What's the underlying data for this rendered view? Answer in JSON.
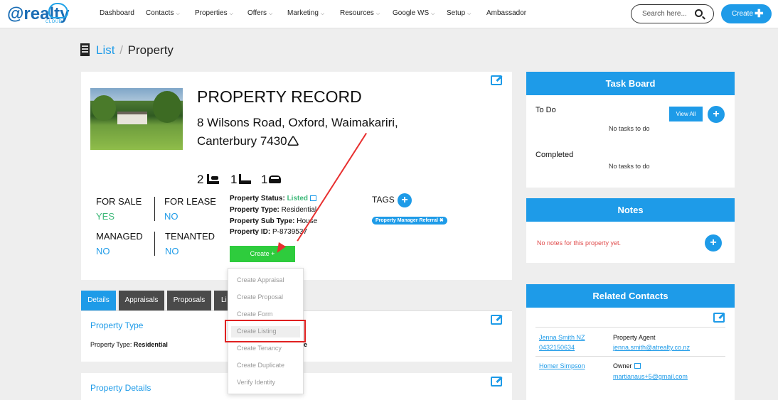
{
  "nav": {
    "logo_text": "@realty",
    "logo_sub": "CLOUD",
    "items": [
      {
        "label": "Dashboard",
        "dropdown": false
      },
      {
        "label": "Contacts",
        "dropdown": true
      },
      {
        "label": "Properties",
        "dropdown": true
      },
      {
        "label": "Offers",
        "dropdown": true
      },
      {
        "label": "Marketing",
        "dropdown": true
      },
      {
        "label": "Resources",
        "dropdown": true
      },
      {
        "label": "Google WS",
        "dropdown": true
      },
      {
        "label": "Setup",
        "dropdown": true
      },
      {
        "label": "Ambassador",
        "dropdown": false
      }
    ],
    "search_placeholder": "Search here...",
    "create_label": "Create",
    "create_plus": "✚"
  },
  "breadcrumb": {
    "parent": "List",
    "separator": "/",
    "current": "Property"
  },
  "record": {
    "title": "PROPERTY RECORD",
    "address": "8 Wilsons Road, Oxford, Waimakariri, Canterbury 7430",
    "address_icon": "🛆",
    "beds": "2",
    "baths": "1",
    "cars": "1",
    "for_sale_label": "FOR SALE",
    "for_sale_value": "YES",
    "for_lease_label": "FOR LEASE",
    "for_lease_value": "NO",
    "managed_label": "MANAGED",
    "managed_value": "NO",
    "tenanted_label": "TENANTED",
    "tenanted_value": "NO",
    "status_label": "Property Status:",
    "status_value": "Listed",
    "type_label": "Property Type:",
    "type_value": "Residential",
    "subtype_label": "Property Sub Type:",
    "subtype_value": "House",
    "id_label": "Property ID:",
    "id_value": "P-8739537",
    "tags_label": "TAGS",
    "tag": "Property Manager Referral ✖",
    "create_button": "Create +"
  },
  "create_menu": {
    "items": [
      "Create Appraisal",
      "Create Proposal",
      "Create Form",
      "Create Listing",
      "Create Tenancy",
      "Create Duplicate",
      "Verify Identity"
    ],
    "highlighted": "Create Listing"
  },
  "tabs": [
    "Details",
    "Appraisals",
    "Proposals",
    "Li"
  ],
  "property_type_section": {
    "title": "Property Type",
    "label": "Property Type:",
    "value": "Residential",
    "subtype_fragment": "e"
  },
  "property_details_section": {
    "title": "Property Details"
  },
  "task_board": {
    "title": "Task Board",
    "todo_label": "To Do",
    "view_all": "View All",
    "no_todo": "No tasks to do",
    "completed_label": "Completed",
    "no_completed": "No tasks to do"
  },
  "notes": {
    "title": "Notes",
    "empty": "No notes for this property yet."
  },
  "related_contacts": {
    "title": "Related Contacts",
    "contacts": [
      {
        "name": "Jenna Smith NZ",
        "phone": "0432150634",
        "role": "Property Agent",
        "email": "jenna.smith@atrealty.co.nz"
      },
      {
        "name": "Homer Simpson",
        "phone": "",
        "role": "Owner",
        "email": "martianaus+5@gmail.com"
      }
    ]
  },
  "colors": {
    "accent": "#1e9be8",
    "green": "#2ecc3d",
    "highlight_red": "#e02020"
  },
  "icons": [
    "building-icon",
    "edit-icon",
    "bed-icon",
    "bath-icon",
    "car-icon",
    "search-icon",
    "plus-icon"
  ]
}
